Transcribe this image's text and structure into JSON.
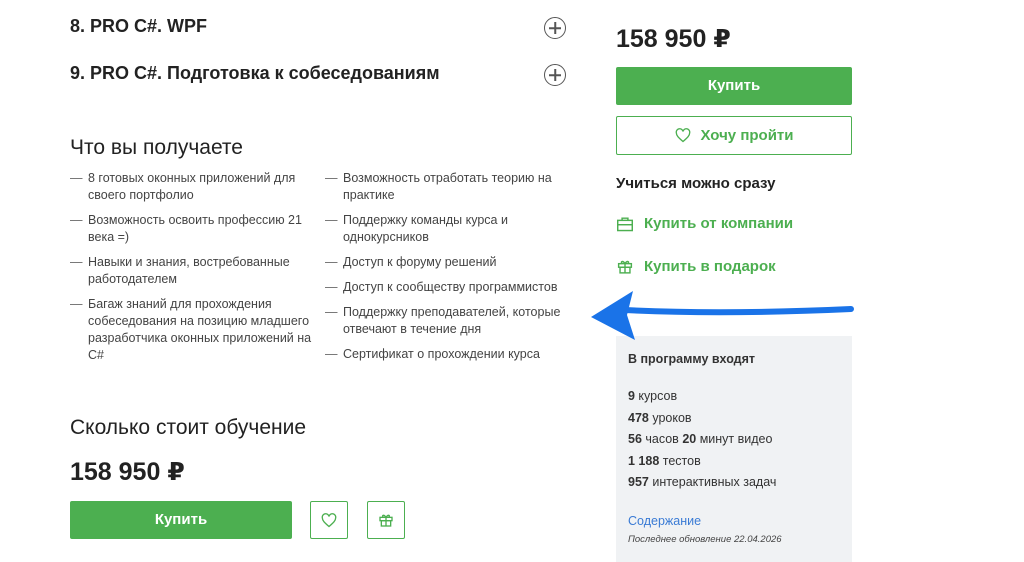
{
  "modules": [
    {
      "label": "8.  PRO C#. WPF"
    },
    {
      "label": "9.  PRO C#. Подготовка к собеседованиям"
    }
  ],
  "benefits": {
    "title": "Что вы получаете",
    "left": [
      "8 готовых оконных приложений для своего портфолио",
      "Возможность освоить профессию 21 века =)",
      "Навыки и знания, востребованные работодателем",
      "Багаж знаний для прохождения собеседования на позицию младшего разработчика оконных приложений на C#"
    ],
    "right": [
      "Возможность отработать теорию на практике",
      "Поддержку команды курса и однокурсников",
      "Доступ к форуму решений",
      "Доступ к сообществу программистов",
      "Поддержку преподавателей, которые отвечают в течение дня",
      "Сертификат о прохождении курса"
    ]
  },
  "pricing": {
    "title": "Сколько стоит обучение",
    "price": "158 950 ₽",
    "buy_label": "Купить"
  },
  "sidebar": {
    "price": "158 950 ₽",
    "buy_label": "Купить",
    "wish_label": "Хочу пройти",
    "study_now": "Учиться можно сразу",
    "company_label": "Купить от компании",
    "gift_label": "Купить в подарок"
  },
  "program": {
    "title": "В программу входят",
    "rows": [
      {
        "num": "9",
        "text": " курсов"
      },
      {
        "num": "478",
        "text": " уроков"
      },
      {
        "num": "56",
        "text": " часов ",
        "num2": "20",
        "text2": " минут видео"
      },
      {
        "num": "1 188",
        "text": " тестов"
      },
      {
        "num": "957",
        "text": " интерактивных задач"
      }
    ],
    "contents_link": "Содержание",
    "updated": "Последнее обновление 22.04.2026"
  },
  "colors": {
    "accent": "#4caf50",
    "arrow": "#1a73e8",
    "link": "#3a7bd5"
  },
  "icons": [
    "plus-icon",
    "heart-icon",
    "gift-icon",
    "briefcase-icon",
    "arrow-left-icon"
  ]
}
